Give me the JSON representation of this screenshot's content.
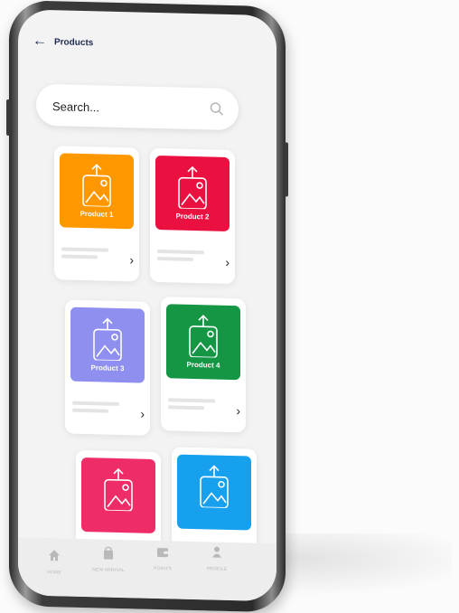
{
  "appbar": {
    "title": "Products"
  },
  "search": {
    "placeholder": "Search..."
  },
  "products": [
    {
      "label": "Product 1",
      "color": "#ff9800"
    },
    {
      "label": "Product 2",
      "color": "#ea1140"
    },
    {
      "label": "Product 3",
      "color": "#8f8ff0"
    },
    {
      "label": "Product 4",
      "color": "#159645"
    },
    {
      "label": "",
      "color": "#ee2d68"
    },
    {
      "label": "",
      "color": "#16a0ee"
    }
  ],
  "nav": [
    {
      "label": "HOME",
      "icon": "home-icon"
    },
    {
      "label": "NEW ARRIVAL",
      "icon": "bag-icon"
    },
    {
      "label": "POINTS",
      "icon": "wallet-icon"
    },
    {
      "label": "PROFILE",
      "icon": "person-icon"
    }
  ]
}
